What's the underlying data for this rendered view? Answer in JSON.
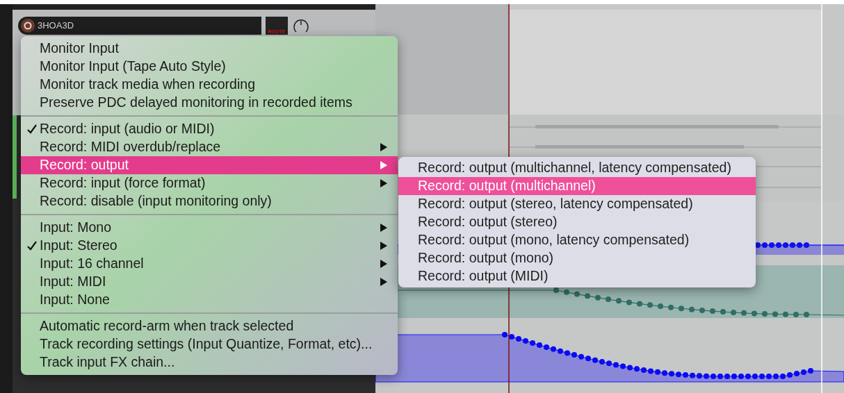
{
  "track": {
    "name": "3HOA3D",
    "route_label": "ROUTE"
  },
  "menu": {
    "sections": [
      {
        "items": [
          {
            "label": "Monitor Input",
            "checked": false,
            "submenu": false,
            "selected": false
          },
          {
            "label": "Monitor Input (Tape Auto Style)",
            "checked": false,
            "submenu": false,
            "selected": false
          },
          {
            "label": "Monitor track media when recording",
            "checked": false,
            "submenu": false,
            "selected": false
          },
          {
            "label": "Preserve PDC delayed monitoring in recorded items",
            "checked": false,
            "submenu": false,
            "selected": false
          }
        ]
      },
      {
        "items": [
          {
            "label": "Record: input (audio or MIDI)",
            "checked": true,
            "submenu": false,
            "selected": false
          },
          {
            "label": "Record: MIDI overdub/replace",
            "checked": false,
            "submenu": true,
            "selected": false
          },
          {
            "label": "Record: output",
            "checked": false,
            "submenu": true,
            "selected": true
          },
          {
            "label": "Record: input (force format)",
            "checked": false,
            "submenu": true,
            "selected": false
          },
          {
            "label": "Record: disable (input monitoring only)",
            "checked": false,
            "submenu": false,
            "selected": false
          }
        ]
      },
      {
        "items": [
          {
            "label": "Input: Mono",
            "checked": false,
            "submenu": true,
            "selected": false
          },
          {
            "label": "Input: Stereo",
            "checked": true,
            "submenu": true,
            "selected": false
          },
          {
            "label": "Input: 16 channel",
            "checked": false,
            "submenu": true,
            "selected": false
          },
          {
            "label": "Input: MIDI",
            "checked": false,
            "submenu": true,
            "selected": false
          },
          {
            "label": "Input: None",
            "checked": false,
            "submenu": false,
            "selected": false
          }
        ]
      },
      {
        "items": [
          {
            "label": "Automatic record-arm when track selected",
            "checked": false,
            "submenu": false,
            "selected": false
          },
          {
            "label": "Track recording settings (Input Quantize, Format, etc)...",
            "checked": false,
            "submenu": false,
            "selected": false
          },
          {
            "label": "Track input FX chain...",
            "checked": false,
            "submenu": false,
            "selected": false
          }
        ]
      }
    ]
  },
  "submenu": {
    "items": [
      {
        "label": "Record: output (multichannel, latency compensated)",
        "selected": false
      },
      {
        "label": "Record: output (multichannel)",
        "selected": true
      },
      {
        "label": "Record: output (stereo, latency compensated)",
        "selected": false
      },
      {
        "label": "Record: output (stereo)",
        "selected": false
      },
      {
        "label": "Record: output (mono, latency compensated)",
        "selected": false
      },
      {
        "label": "Record: output (mono)",
        "selected": false
      },
      {
        "label": "Record: output (MIDI)",
        "selected": false
      }
    ]
  }
}
